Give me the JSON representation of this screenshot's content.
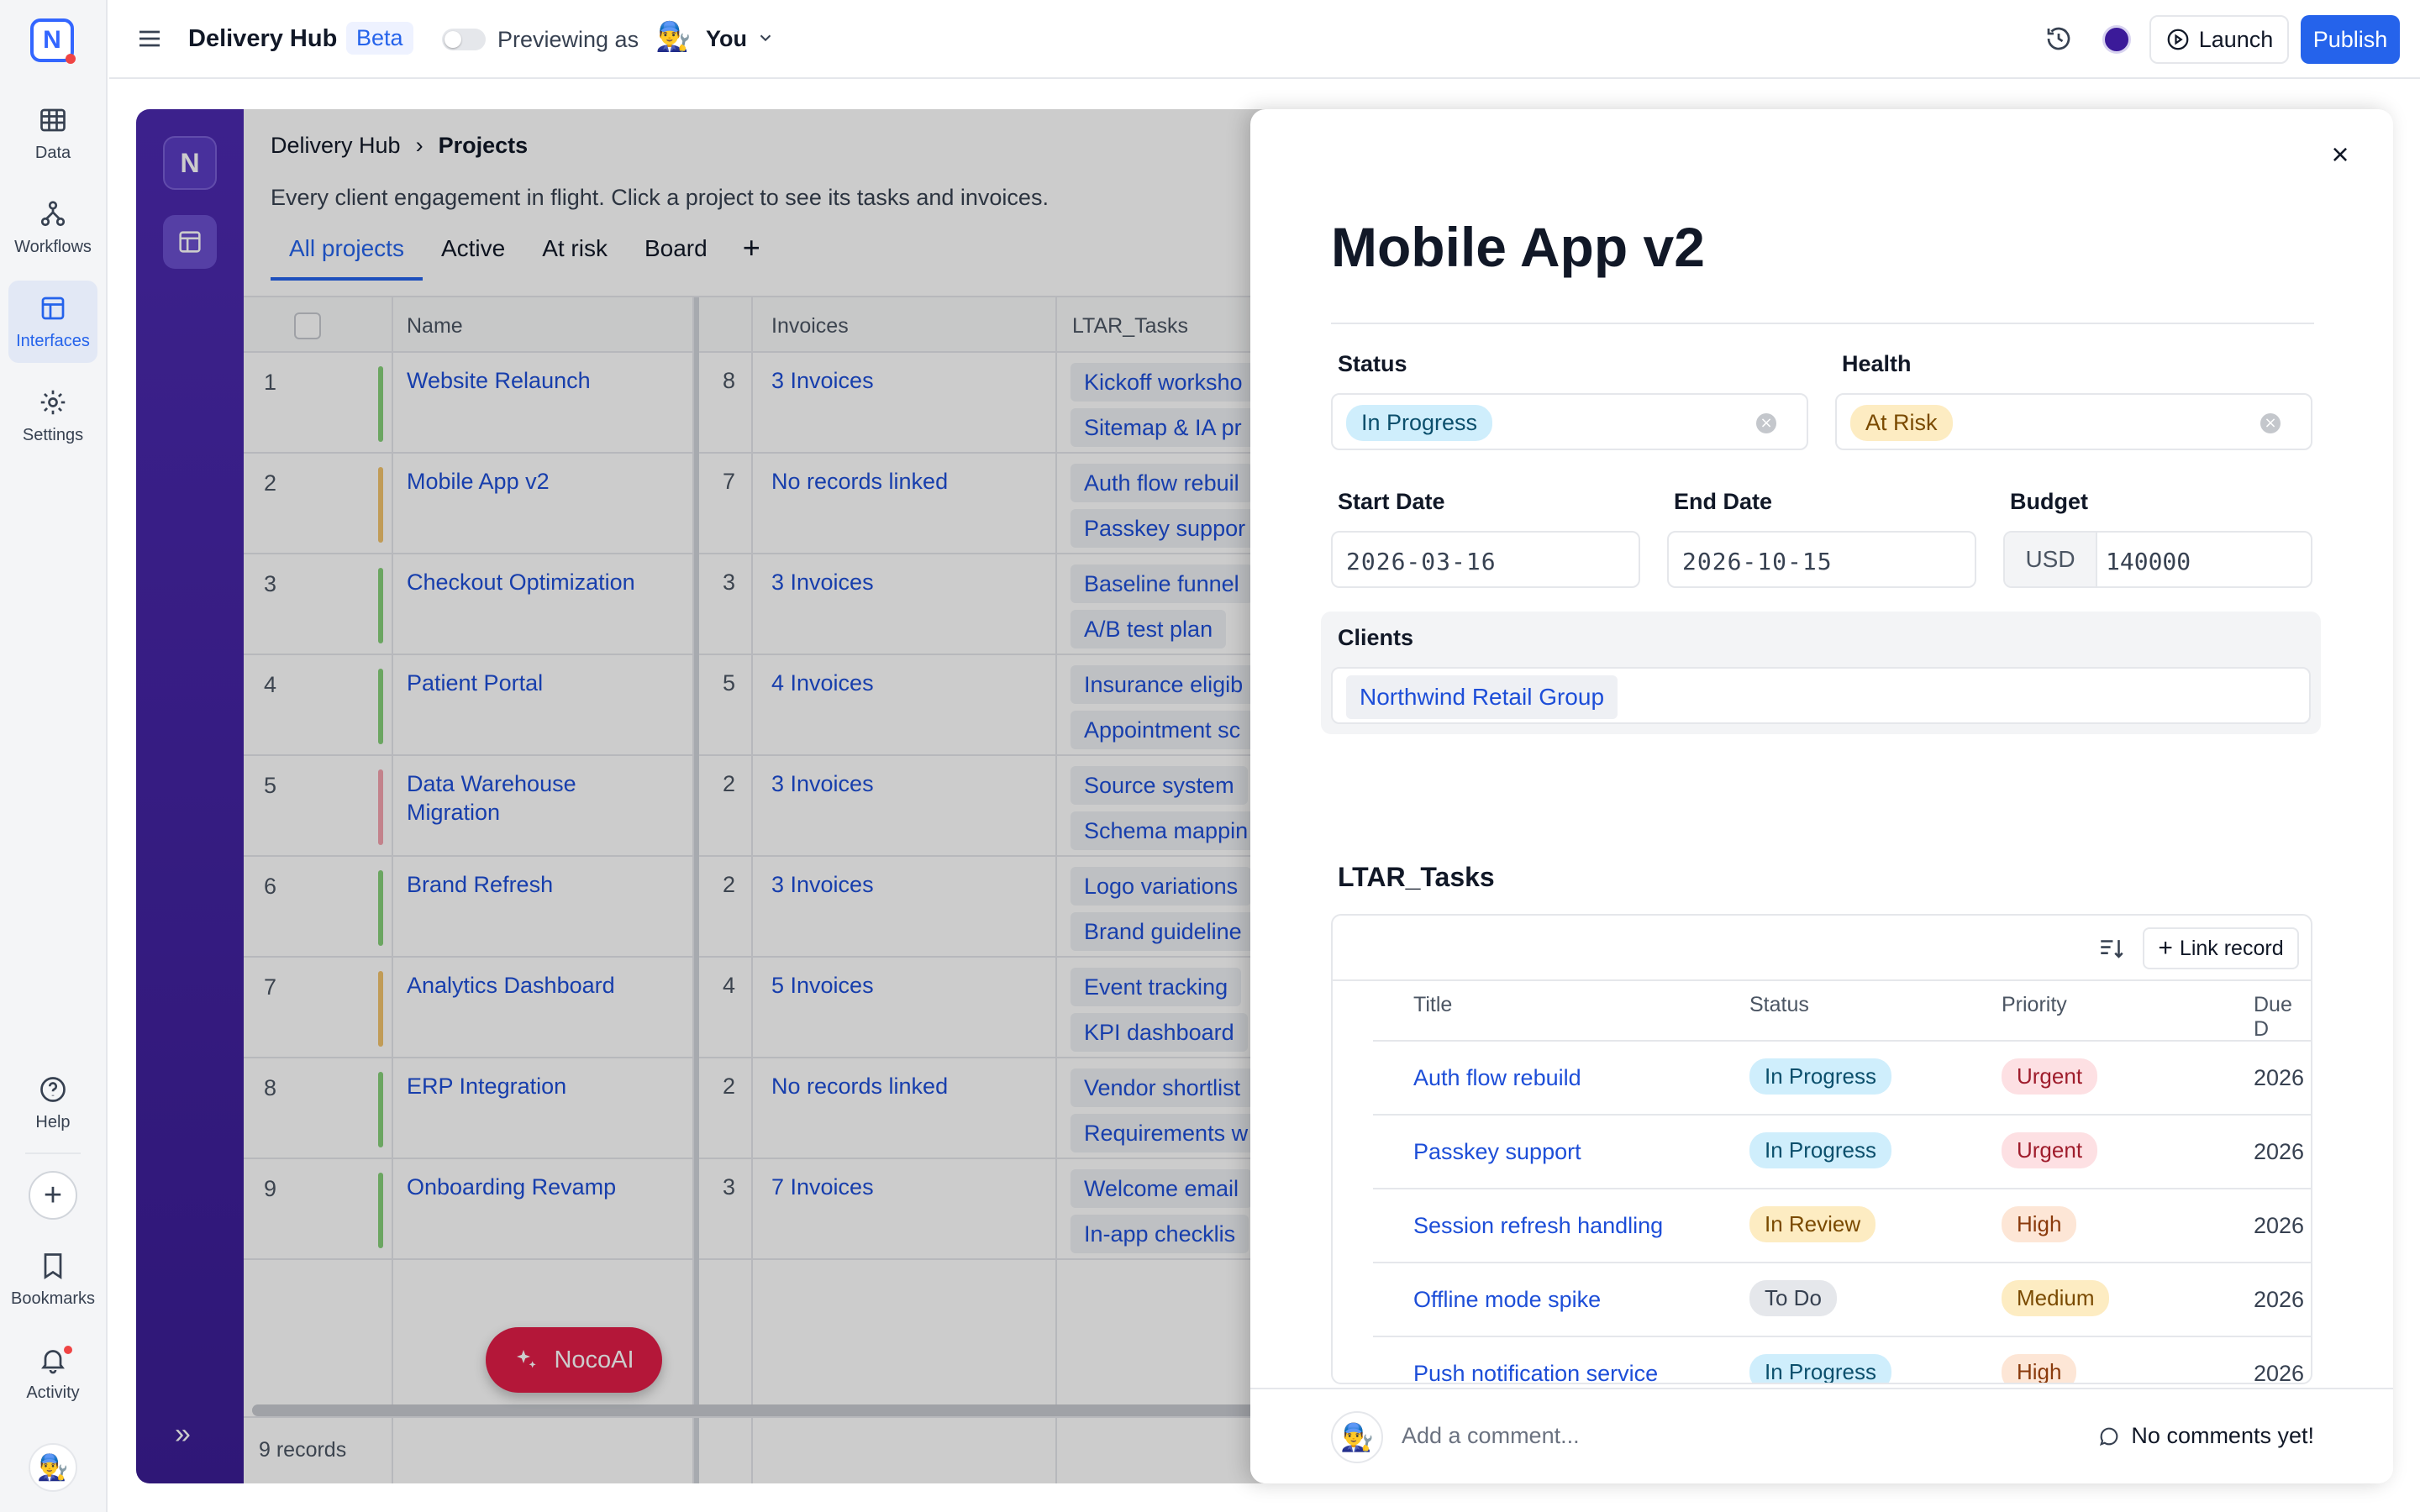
{
  "rail": {
    "items": [
      {
        "label": "Data",
        "icon": "table-icon"
      },
      {
        "label": "Workflows",
        "icon": "workflow-icon"
      },
      {
        "label": "Interfaces",
        "icon": "interface-icon"
      },
      {
        "label": "Settings",
        "icon": "gear-icon"
      }
    ],
    "help": "Help",
    "bookmarks": "Bookmarks",
    "activity": "Activity"
  },
  "topbar": {
    "title": "Delivery Hub",
    "badge": "Beta",
    "previewing": "Previewing as",
    "user": "You",
    "launch": "Launch",
    "publish": "Publish"
  },
  "page": {
    "breadcrumb_root": "Delivery Hub",
    "breadcrumb_current": "Projects",
    "subtitle": "Every client engagement in flight. Click a project to see its tasks and invoices.",
    "tabs": [
      "All projects",
      "Active",
      "At risk",
      "Board"
    ],
    "columns": {
      "name": "Name",
      "invoices": "Invoices",
      "tasks": "LTAR_Tasks"
    },
    "rows": [
      {
        "n": "1",
        "name": "Website Relaunch",
        "cnt": "8",
        "inv": "3 Invoices",
        "t1": "Kickoff worksho",
        "t2": "Sitemap & IA pr",
        "color": "#86d07a"
      },
      {
        "n": "2",
        "name": "Mobile App v2",
        "cnt": "7",
        "inv": "No records linked",
        "t1": "Auth flow rebuil",
        "t2": "Passkey suppor",
        "color": "#f2c46d"
      },
      {
        "n": "3",
        "name": "Checkout Optimization",
        "cnt": "3",
        "inv": "3 Invoices",
        "t1": "Baseline funnel",
        "t2": "A/B test plan",
        "color": "#86d07a"
      },
      {
        "n": "4",
        "name": "Patient Portal",
        "cnt": "5",
        "inv": "4 Invoices",
        "t1": "Insurance eligib",
        "t2": "Appointment sc",
        "color": "#86d07a"
      },
      {
        "n": "5",
        "name": "Data Warehouse Migration",
        "cnt": "2",
        "inv": "3 Invoices",
        "t1": "Source system",
        "t2": "Schema mappin",
        "color": "#f4a3ae"
      },
      {
        "n": "6",
        "name": "Brand Refresh",
        "cnt": "2",
        "inv": "3 Invoices",
        "t1": "Logo variations",
        "t2": "Brand guideline",
        "color": "#86d07a"
      },
      {
        "n": "7",
        "name": "Analytics Dashboard",
        "cnt": "4",
        "inv": "5 Invoices",
        "t1": "Event tracking",
        "t2": "KPI dashboard",
        "color": "#f2c46d"
      },
      {
        "n": "8",
        "name": "ERP Integration",
        "cnt": "2",
        "inv": "No records linked",
        "t1": "Vendor shortlist",
        "t2": "Requirements w",
        "color": "#86d07a"
      },
      {
        "n": "9",
        "name": "Onboarding Revamp",
        "cnt": "3",
        "inv": "7 Invoices",
        "t1": "Welcome email",
        "t2": "In-app checklis",
        "color": "#86d07a"
      }
    ],
    "record_count": "9 records",
    "nocoai": "NocoAI"
  },
  "drawer": {
    "title": "Mobile App v2",
    "status_label": "Status",
    "status_value": "In Progress",
    "health_label": "Health",
    "health_value": "At Risk",
    "start_label": "Start Date",
    "start_value": "2026-03-16",
    "end_label": "End Date",
    "end_value": "2026-10-15",
    "budget_label": "Budget",
    "budget_currency": "USD",
    "budget_value": "140000",
    "clients_label": "Clients",
    "clients_value": "Northwind Retail Group",
    "ltar_title": "LTAR_Tasks",
    "link_record": "Link record",
    "cols": {
      "title": "Title",
      "status": "Status",
      "priority": "Priority",
      "due": "Due D"
    },
    "tasks": [
      {
        "title": "Auth flow rebuild",
        "status": "In Progress",
        "priority": "Urgent",
        "due": "2026"
      },
      {
        "title": "Passkey support",
        "status": "In Progress",
        "priority": "Urgent",
        "due": "2026"
      },
      {
        "title": "Session refresh handling",
        "status": "In Review",
        "priority": "High",
        "due": "2026"
      },
      {
        "title": "Offline mode spike",
        "status": "To Do",
        "priority": "Medium",
        "due": "2026"
      },
      {
        "title": "Push notification service",
        "status": "In Progress",
        "priority": "High",
        "due": "2026"
      }
    ],
    "comment_placeholder": "Add a comment...",
    "no_comments": "No comments yet!"
  },
  "colors": {
    "accent": "#2563eb",
    "sidebar": "#3b1d95",
    "danger": "#e11d48"
  }
}
